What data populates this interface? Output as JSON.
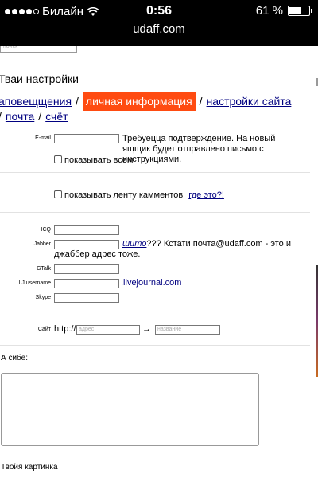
{
  "status_bar": {
    "carrier": "Билайн",
    "time": "0:56",
    "battery_percent": "61 %",
    "battery_level": 0.61,
    "url": "udaff.com"
  },
  "search": {
    "placeholder": "поиск"
  },
  "page_title": "Тваи настройки",
  "tabs": [
    {
      "label": "аповещщения",
      "active": false
    },
    {
      "label": "личная информация",
      "active": true
    },
    {
      "label": "настройки сайта",
      "active": false
    },
    {
      "label": "почта",
      "active": false
    },
    {
      "label": "счёт",
      "active": false
    }
  ],
  "tab_separator": "/",
  "email": {
    "label": "E-mail",
    "note": "Требуецца подтверждение. На новый ящщик будет отправлено письмо с инструкциями.",
    "show_all_label": "показывать всем"
  },
  "feed": {
    "label": "показывать ленту камментов",
    "help_link": "где это?!"
  },
  "messengers": {
    "icq_label": "ICQ",
    "jabber_label": "Jabber",
    "jabber_link": "шито",
    "jabber_note": "??? Кстати почта@udaff.com - это и джаббер адрес тоже.",
    "gtalk_label": "GTalk",
    "lj_label": "LJ username",
    "lj_suffix": ".livejournal.com",
    "skype_label": "Skype"
  },
  "site": {
    "label": "Сайт",
    "prefix": "http://",
    "address_placeholder": "адрес",
    "arrow": "→",
    "name_placeholder": "название"
  },
  "about_label": "А сибе:",
  "picture_label": "Твойя картинка",
  "colors": {
    "active_tab": "#ff4b11",
    "link": "#000080"
  }
}
